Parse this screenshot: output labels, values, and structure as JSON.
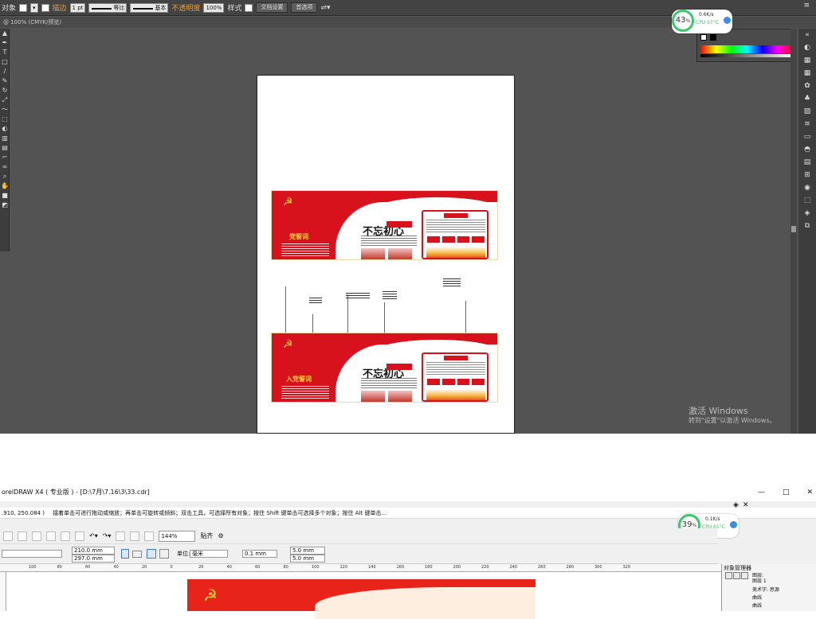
{
  "top_app": {
    "control_bar": {
      "selection_label": "对象",
      "opacity_label": "描边",
      "stroke_weight": "1 pt",
      "stroke_profile": "等比",
      "brush": "基本",
      "opacity_text": "不透明度",
      "opacity_value": "100%",
      "style_label": "样式",
      "doc_setup_button": "文档设置",
      "prefs_button": "首选项"
    },
    "doc_tab": "@ 100% (CMYK/预览)",
    "watermark_title": "激活 Windows",
    "watermark_sub": "转到\"设置\"以激活 Windows。"
  },
  "cpu_widget_top": {
    "percent": "43",
    "unit": "%",
    "speed": "0.6K/s",
    "temp": "CPU 57°C"
  },
  "cpu_widget_bottom": {
    "percent": "39",
    "unit": "%",
    "speed": "0.1K/s",
    "temp": "CPU 61°C"
  },
  "design": {
    "panel1_title": "党誓词",
    "panel2_title": "入党誓词",
    "calligraphy": "不忘初心",
    "box_title": "工作分组",
    "logo_glyph": "☭"
  },
  "bottom_app": {
    "window_title": "orelDRAW X4 ( 专业版 ) - [D:\\7月\\7.16\\3\\33.cdr]",
    "status_coords": ".910, 250.084 )",
    "status_hint": "接着单击可进行拖动或缩放；再单击可旋转或倾斜；双击工具，可选择所有对象；按住 Shift 键单击可选择多个对象；按住 Alt 键单击...",
    "zoom": "144%",
    "snap_label": "贴齐",
    "width": "210.0 mm",
    "height": "297.0 mm",
    "units_label": "单位:",
    "units_value": "毫米",
    "nudge": "0.1 mm",
    "dup_x": "5.0 mm",
    "dup_y": "5.0 mm",
    "ruler_marks": [
      "100",
      "80",
      "60",
      "40",
      "20",
      "0",
      "20",
      "40",
      "60",
      "80",
      "100",
      "120",
      "140",
      "160",
      "180",
      "200",
      "220",
      "240",
      "260",
      "280",
      "300",
      "320"
    ],
    "object_manager": {
      "title": "对象管理器",
      "page_label": "图层:",
      "page_value": "图层 1",
      "items": [
        "美术字: 思源",
        "曲线",
        "曲线"
      ]
    },
    "win_controls": [
      "—",
      "□",
      "✕"
    ]
  }
}
